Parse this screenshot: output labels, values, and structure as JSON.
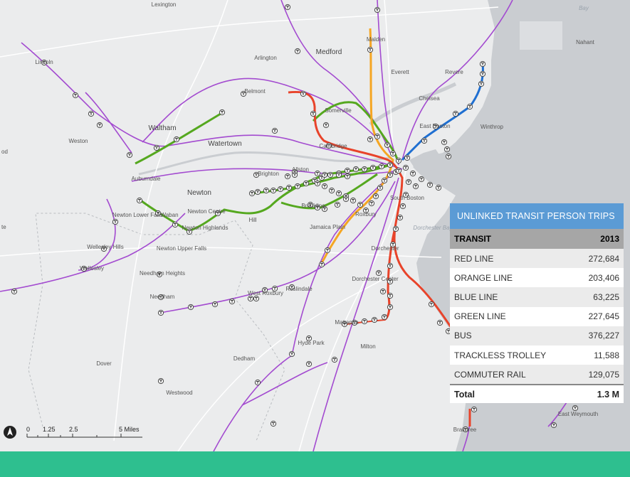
{
  "map": {
    "places": [
      {
        "id": "lexington",
        "label": "Lexington"
      },
      {
        "id": "malden",
        "label": "Malden"
      },
      {
        "id": "arlington",
        "label": "Arlington"
      },
      {
        "id": "medford",
        "label": "Medford"
      },
      {
        "id": "lincoln",
        "label": "Lincoln"
      },
      {
        "id": "everett",
        "label": "Everett"
      },
      {
        "id": "revere",
        "label": "Revere"
      },
      {
        "id": "nahant",
        "label": "Nahant"
      },
      {
        "id": "belmont",
        "label": "Belmont"
      },
      {
        "id": "somerville",
        "label": "Somerville"
      },
      {
        "id": "chelsea",
        "label": "Chelsea"
      },
      {
        "id": "weston",
        "label": "Weston"
      },
      {
        "id": "waltham",
        "label": "Waltham"
      },
      {
        "id": "watertown",
        "label": "Watertown"
      },
      {
        "id": "cambridge",
        "label": "Cambridge"
      },
      {
        "id": "eastboston",
        "label": "East Boston"
      },
      {
        "id": "winthrop",
        "label": "Winthrop"
      },
      {
        "id": "auburndale",
        "label": "Auburndale"
      },
      {
        "id": "brighton",
        "label": "Brighton"
      },
      {
        "id": "allston",
        "label": "Allston"
      },
      {
        "id": "newton",
        "label": "Newton"
      },
      {
        "id": "southboston",
        "label": "South Boston"
      },
      {
        "id": "newtonlowerfalls",
        "label": "Newton Lower Falls"
      },
      {
        "id": "waban",
        "label": "Waban"
      },
      {
        "id": "newtoncentre",
        "label": "Newton Centre"
      },
      {
        "id": "newtonhighlands",
        "label": "Newton Highlands"
      },
      {
        "id": "chestnuthill",
        "label": "Hill"
      },
      {
        "id": "brookline",
        "label": "Brookline"
      },
      {
        "id": "roxbury",
        "label": "Roxbury"
      },
      {
        "id": "jamaicaplain",
        "label": "Jamaica Plain"
      },
      {
        "id": "dorchesterbay",
        "label": "Dorchester Bay"
      },
      {
        "id": "dorchester",
        "label": "Dorchester"
      },
      {
        "id": "wellesleyhills",
        "label": "Wellesley Hills"
      },
      {
        "id": "newtonupperfalls",
        "label": "Newton Upper Falls"
      },
      {
        "id": "wellesley",
        "label": "Wellesley"
      },
      {
        "id": "needhamheights",
        "label": "Needham Heights"
      },
      {
        "id": "needham",
        "label": "Needham"
      },
      {
        "id": "dorchestercenter",
        "label": "Dorchester Center"
      },
      {
        "id": "westroxbury",
        "label": "West Roxbury"
      },
      {
        "id": "roslindale",
        "label": "Roslindale"
      },
      {
        "id": "mattapan",
        "label": "Mattapan"
      },
      {
        "id": "hydepark",
        "label": "Hyde Park"
      },
      {
        "id": "milton",
        "label": "Milton"
      },
      {
        "id": "dover",
        "label": "Dover"
      },
      {
        "id": "dedham",
        "label": "Dedham"
      },
      {
        "id": "westwood",
        "label": "Westwood"
      },
      {
        "id": "eastweymouth",
        "label": "East Weymouth"
      },
      {
        "id": "braintree",
        "label": "Braintree"
      },
      {
        "id": "nahantbay",
        "label": "Bay"
      },
      {
        "id": "leftedge",
        "label": "od"
      },
      {
        "id": "leftedge2",
        "label": "te"
      }
    ],
    "line_colors": {
      "red": "#e8432a",
      "orange": "#f5a623",
      "blue": "#1f6fd1",
      "green": "#55a81f",
      "commuter_rail": "#a34bd0"
    },
    "station_icon": "t-station-icon",
    "north_arrow": "north-arrow-icon",
    "scale": {
      "ticks": [
        "0",
        "1.25",
        "2.5",
        "5 Miles"
      ]
    }
  },
  "panel": {
    "title": "UNLINKED TRANSIT PERSON TRIPS",
    "header": {
      "col1": "TRANSIT",
      "col2": "2013"
    },
    "rows": [
      {
        "label": "RED LINE",
        "value": "272,684"
      },
      {
        "label": "ORANGE LINE",
        "value": "203,406"
      },
      {
        "label": "BLUE LINE",
        "value": "63,225"
      },
      {
        "label": "GREEN LINE",
        "value": "227,645"
      },
      {
        "label": "BUS",
        "value": "376,227"
      },
      {
        "label": "TRACKLESS TROLLEY",
        "value": "11,588"
      },
      {
        "label": "COMMUTER RAIL",
        "value": "129,075"
      }
    ],
    "total": {
      "label": "Total",
      "value": "1.3 M"
    }
  }
}
